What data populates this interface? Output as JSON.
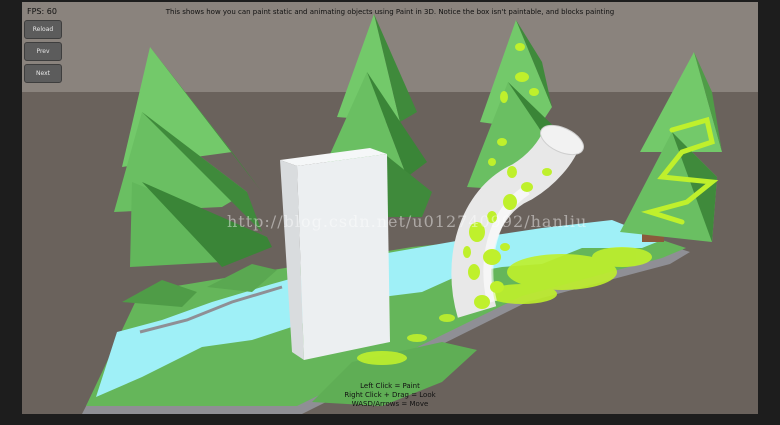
{
  "hud": {
    "fps": "FPS: 60",
    "hint": "This shows how you can paint static and animating objects using Paint in 3D. Notice the box isn't paintable, and blocks painting",
    "buttons": {
      "reload": "Reload",
      "prev": "Prev",
      "next": "Next"
    },
    "controls": [
      "Left Click = Paint",
      "Right Click + Drag = Look",
      "WASD/Arrows = Move"
    ]
  },
  "watermark": "http://blog.csdn.net/u012740992/hanliu",
  "colors": {
    "sky": "#8a837d",
    "ground": "#6a625c",
    "grass": "#65b65a",
    "grass_dark": "#4f9c47",
    "water": "#9ff0f7",
    "platform_edge": "#8f8f95",
    "tree_light": "#73c96a",
    "tree_dark": "#3f8a3b",
    "trunk": "#8a5a3c",
    "paint": "#bff02c",
    "box": "#eceff1"
  },
  "icons": {
    "tree": "low-poly-tree",
    "tube": "bent-tube",
    "box": "white-box"
  }
}
